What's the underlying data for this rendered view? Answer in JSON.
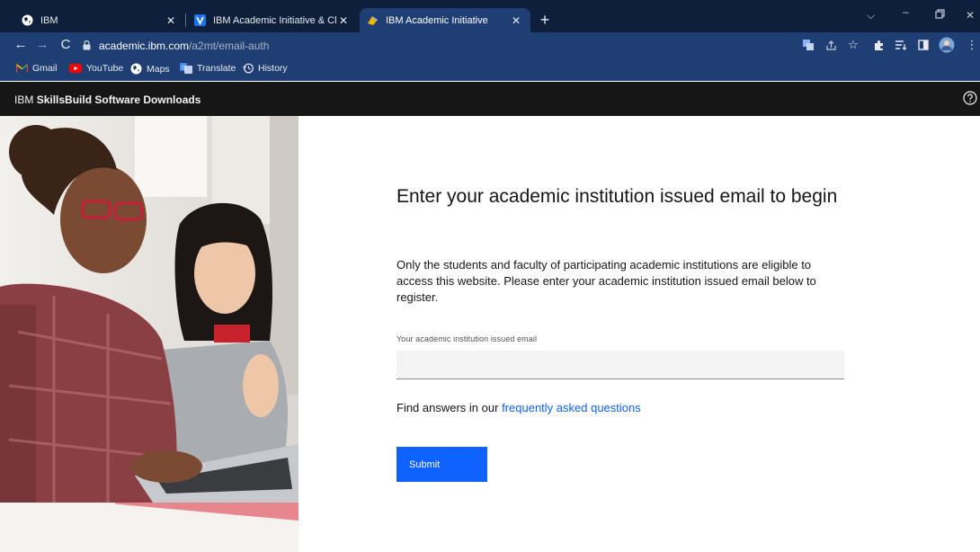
{
  "browser": {
    "tabs": [
      {
        "title": "IBM",
        "favicon": "globe-icon",
        "active": false
      },
      {
        "title": "IBM Academic Initiative & Cloud",
        "favicon": "ibm-v-icon",
        "active": false
      },
      {
        "title": "IBM Academic Initiative",
        "favicon": "academic-cap-icon",
        "active": true
      }
    ],
    "new_tab_label": "+",
    "url_domain": "academic.ibm.com",
    "url_path": "/a2mt/email-auth",
    "bookmarks": [
      {
        "label": "Gmail",
        "icon": "gmail-icon"
      },
      {
        "label": "YouTube",
        "icon": "youtube-icon"
      },
      {
        "label": "Maps",
        "icon": "maps-icon"
      },
      {
        "label": "Translate",
        "icon": "translate-icon"
      },
      {
        "label": "History",
        "icon": "history-icon"
      }
    ]
  },
  "header": {
    "brand_prefix": "IBM",
    "brand_name": "SkillsBuild Software Downloads",
    "help_icon": "help-icon"
  },
  "main": {
    "title": "Enter your academic institution issued email to begin",
    "description": "Only the students and faculty of participating academic institutions are eligible to access this website. Please enter your academic institution issued email below to register.",
    "email_label": "Your academic institution issued email",
    "email_value": "",
    "faq_prefix": "Find answers in our",
    "faq_link": "frequently asked questions",
    "submit_label": "Submit"
  },
  "colors": {
    "accent": "#0f62fe",
    "header_bg": "#161616",
    "browser_toolbar": "#1f3f74",
    "browser_tabstrip": "#0d1f3a"
  }
}
